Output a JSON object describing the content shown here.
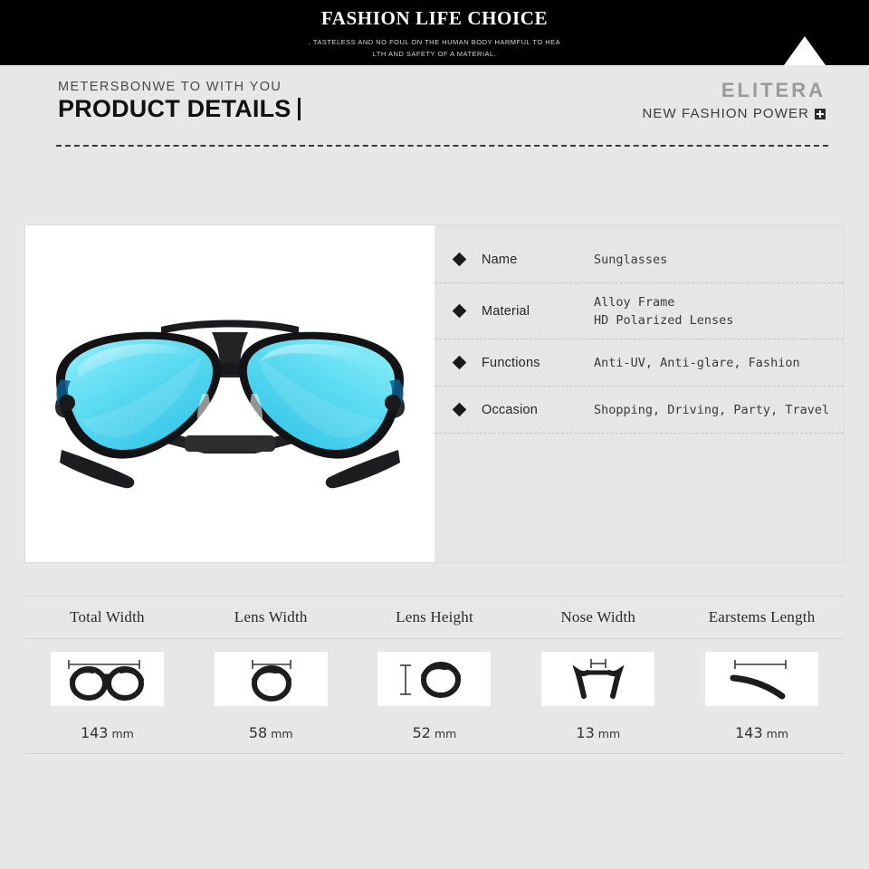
{
  "banner": {
    "title": "FASHION LIFE CHOICE",
    "subtitle_line1": ", TASTELESS AND NO FOUL ON THE HUMAN BODY HARMFUL TO HEA",
    "subtitle_line2": "LTH AND SAFETY OF A MATERIAL.",
    "background_color": "#000000",
    "triangle_color": "#ffffff"
  },
  "header": {
    "kicker": "METERSBONWE TO WITH YOU",
    "title": "PRODUCT DETAILS",
    "brand_name": "ELITERA",
    "brand_tagline": "NEW FASHION POWER",
    "brand_badge_icon": "plus-square-icon"
  },
  "product": {
    "photo_alt": "aviator-sunglasses",
    "lens_color": "#6fe6f5",
    "frame_color": "#1e1e20",
    "specs": [
      {
        "label": "Name",
        "value": "Sunglasses"
      },
      {
        "label": "Material",
        "value": "Alloy Frame\nHD Polarized Lenses"
      },
      {
        "label": "Functions",
        "value": "Anti-UV, Anti-glare, Fashion"
      },
      {
        "label": "Occasion",
        "value": "Shopping, Driving, Party, Travel"
      }
    ]
  },
  "measurements": {
    "headers": [
      "Total Width",
      "Lens Width",
      "Lens Height",
      "Nose Width",
      "Earstems Length"
    ],
    "icons": [
      "total-width-icon",
      "lens-width-icon",
      "lens-height-icon",
      "nose-width-icon",
      "earstems-length-icon"
    ],
    "values": [
      "143",
      "58",
      "52",
      "13",
      "143"
    ],
    "unit": "mm"
  }
}
